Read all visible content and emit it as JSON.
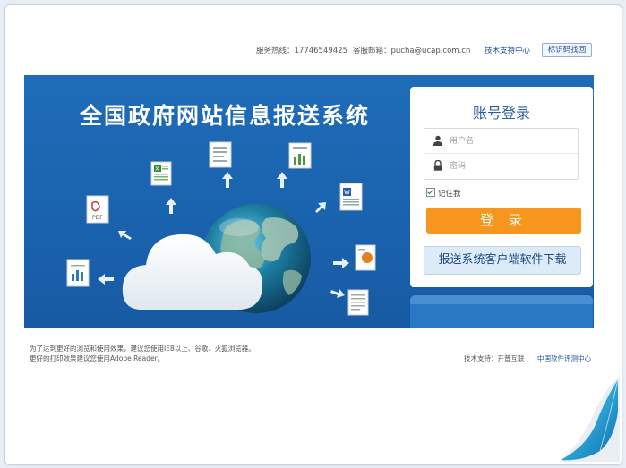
{
  "header": {
    "hotline": "服务热线：17746549425",
    "email": "客服邮箱：pucha@ucap.com.cn",
    "support_link": "技术支持中心",
    "trace_button": "标识码找回"
  },
  "banner": {
    "title": "全国政府网站信息报送系统",
    "doc_icons": [
      "excel-file",
      "report-file",
      "chart-file",
      "pdf-file",
      "word-file",
      "ppt-file",
      "sheet-file",
      "table-file"
    ]
  },
  "login": {
    "title": "账号登录",
    "username_placeholder": "用户名",
    "password_placeholder": "密码",
    "remember_label": "记住我",
    "remember_checked": true,
    "login_button": "登 录",
    "download_button": "报送系统客户端软件下载"
  },
  "footer": {
    "tip_line1": "为了达到更好的浏览和使用效果，建议您使用IE8以上、谷歌、火狐浏览器。",
    "tip_line2": "更好的打印效果建议您使用Adobe Reader。",
    "tech_support": "技术支持：开普互联",
    "center_link": "中国软件评测中心"
  },
  "colors": {
    "banner_blue": "#1a62ad",
    "login_orange": "#f7961e",
    "title_blue": "#2a5da5"
  }
}
